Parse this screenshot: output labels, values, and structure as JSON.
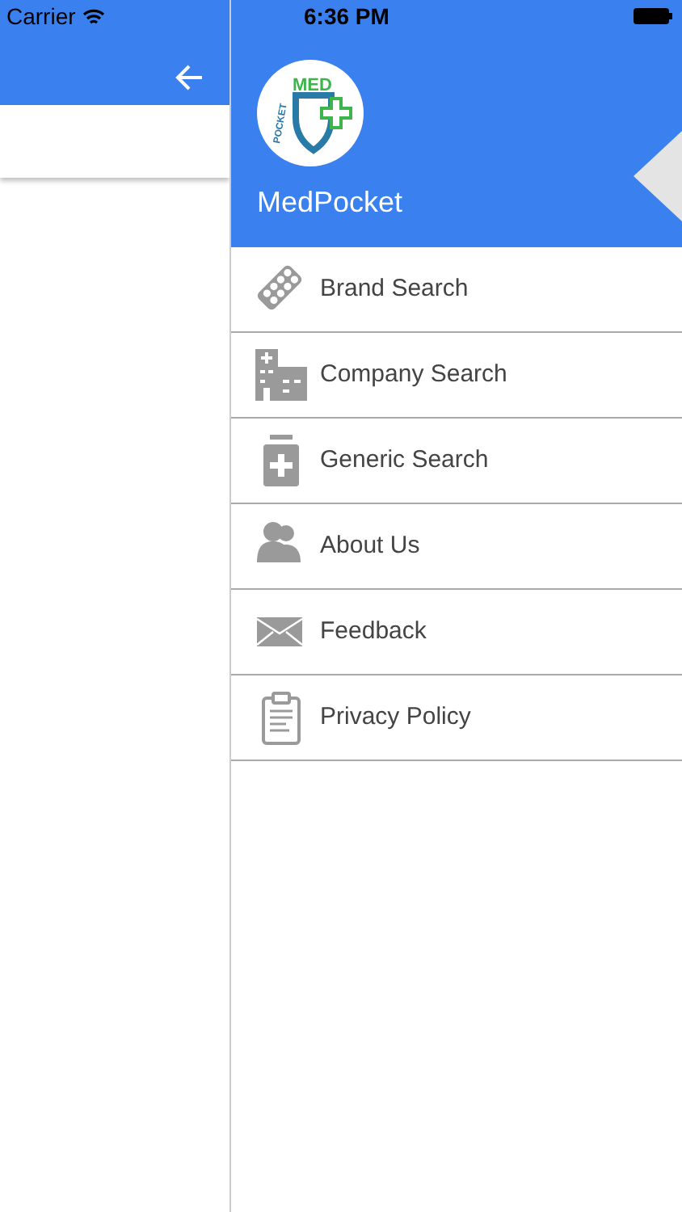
{
  "status_bar": {
    "carrier": "Carrier",
    "time": "6:36 PM"
  },
  "drawer": {
    "logo_texts": [
      "MED",
      "POCKET"
    ],
    "app_name": "MedPocket",
    "items": [
      {
        "kind": "pills",
        "label": "Brand Search"
      },
      {
        "kind": "building",
        "label": "Company Search"
      },
      {
        "kind": "bottle",
        "label": "Generic Search"
      },
      {
        "kind": "people",
        "label": "About Us"
      },
      {
        "kind": "envelope",
        "label": "Feedback"
      },
      {
        "kind": "clipboard",
        "label": "Privacy Policy"
      }
    ]
  }
}
